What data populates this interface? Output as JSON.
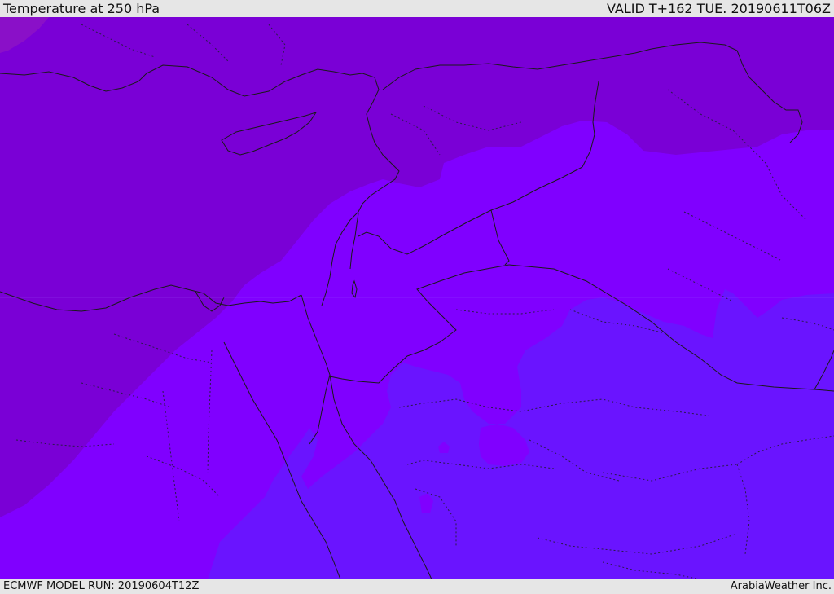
{
  "header": {
    "title": "Temperature at 250 hPa",
    "valid": "VALID T+162 TUE. 20190611T06Z"
  },
  "footer": {
    "model_run": "ECMWF MODEL RUN: 20190604T12Z",
    "credit": "ArabiaWeather Inc."
  },
  "map": {
    "fill_colors": {
      "cold": "#7a00d6",
      "mid": "#8000ff",
      "warm": "#6a14ff",
      "coldest": "#8a10c8"
    },
    "border_color": "#1a1a1a"
  }
}
